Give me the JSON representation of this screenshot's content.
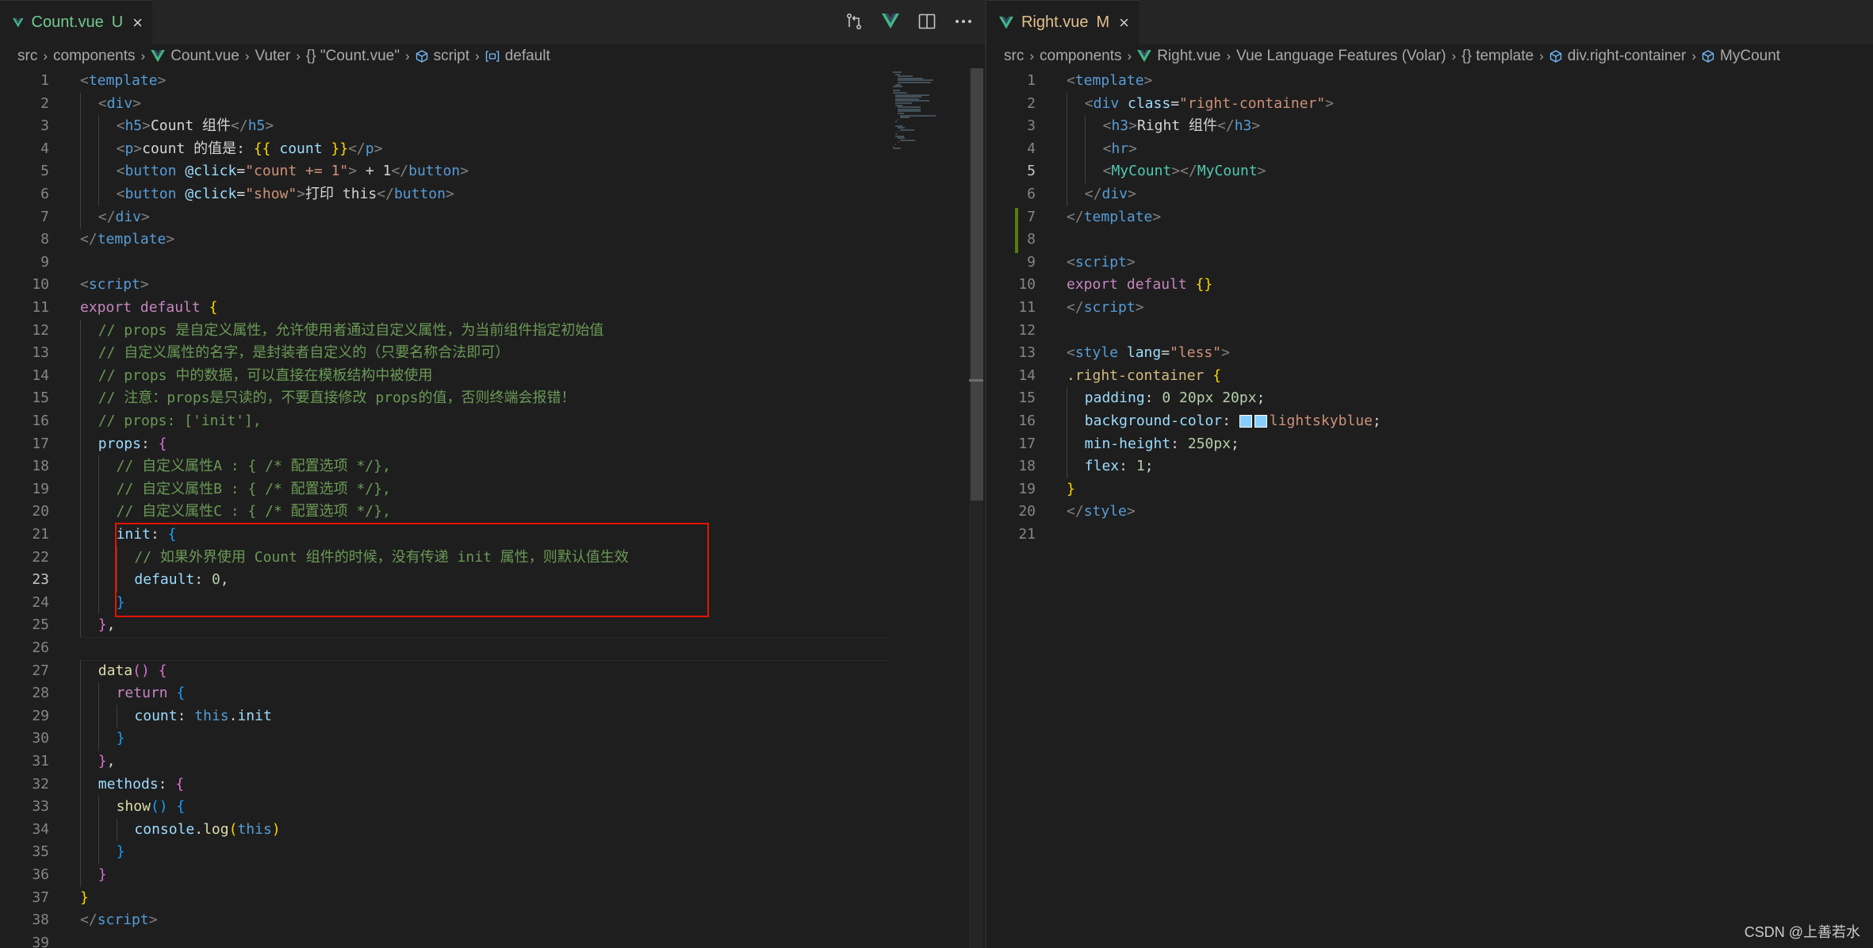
{
  "colors": {
    "background": "#1e1e1e",
    "tabbar": "#252526",
    "highlight": "#e51400",
    "git_modified": "#587c0c",
    "swatch": "#87cefa"
  },
  "left": {
    "tab": {
      "name": "Count.vue",
      "status": "U",
      "close": "×"
    },
    "breadcrumb": [
      "src",
      "components",
      "Count.vue",
      "Vuter",
      "{} \"Count.vue\"",
      "script",
      "default"
    ],
    "actions": [
      "open-changes-icon",
      "vue-preview-icon",
      "split-editor-icon",
      "more-actions-icon"
    ],
    "active_line": 23,
    "lines": [
      {
        "n": "1",
        "indent": 0,
        "t": [
          [
            "tag",
            "<"
          ],
          [
            "name",
            "template"
          ],
          [
            "tag",
            ">"
          ]
        ]
      },
      {
        "n": "2",
        "indent": 1,
        "t": [
          [
            "tag",
            "<"
          ],
          [
            "name",
            "div"
          ],
          [
            "tag",
            ">"
          ]
        ]
      },
      {
        "n": "3",
        "indent": 2,
        "t": [
          [
            "tag",
            "<"
          ],
          [
            "name",
            "h5"
          ],
          [
            "tag",
            ">"
          ],
          [
            "text",
            "Count 组件"
          ],
          [
            "tag",
            "</"
          ],
          [
            "name",
            "h5"
          ],
          [
            "tag",
            ">"
          ]
        ]
      },
      {
        "n": "4",
        "indent": 2,
        "t": [
          [
            "tag",
            "<"
          ],
          [
            "name",
            "p"
          ],
          [
            "tag",
            ">"
          ],
          [
            "text",
            "count 的值是: "
          ],
          [
            "b1",
            "{{"
          ],
          [
            "text",
            " "
          ],
          [
            "attr",
            "count"
          ],
          [
            "text",
            " "
          ],
          [
            "b1",
            "}}"
          ],
          [
            "tag",
            "</"
          ],
          [
            "name",
            "p"
          ],
          [
            "tag",
            ">"
          ]
        ]
      },
      {
        "n": "5",
        "indent": 2,
        "t": [
          [
            "tag",
            "<"
          ],
          [
            "name",
            "button"
          ],
          [
            "text",
            " "
          ],
          [
            "attr",
            "@click"
          ],
          [
            "text",
            "="
          ],
          [
            "str",
            "\"count += 1\""
          ],
          [
            "tag",
            ">"
          ],
          [
            "text",
            " + 1"
          ],
          [
            "tag",
            "</"
          ],
          [
            "name",
            "button"
          ],
          [
            "tag",
            ">"
          ]
        ]
      },
      {
        "n": "6",
        "indent": 2,
        "t": [
          [
            "tag",
            "<"
          ],
          [
            "name",
            "button"
          ],
          [
            "text",
            " "
          ],
          [
            "attr",
            "@click"
          ],
          [
            "text",
            "="
          ],
          [
            "str",
            "\"show\""
          ],
          [
            "tag",
            ">"
          ],
          [
            "text",
            "打印 this"
          ],
          [
            "tag",
            "</"
          ],
          [
            "name",
            "button"
          ],
          [
            "tag",
            ">"
          ]
        ]
      },
      {
        "n": "7",
        "indent": 1,
        "t": [
          [
            "tag",
            "</"
          ],
          [
            "name",
            "div"
          ],
          [
            "tag",
            ">"
          ]
        ]
      },
      {
        "n": "8",
        "indent": 0,
        "t": [
          [
            "tag",
            "</"
          ],
          [
            "name",
            "template"
          ],
          [
            "tag",
            ">"
          ]
        ]
      },
      {
        "n": "9",
        "indent": 0,
        "t": []
      },
      {
        "n": "10",
        "indent": 0,
        "t": [
          [
            "tag",
            "<"
          ],
          [
            "name",
            "script"
          ],
          [
            "tag",
            ">"
          ]
        ]
      },
      {
        "n": "11",
        "indent": 0,
        "t": [
          [
            "kw",
            "export"
          ],
          [
            "text",
            " "
          ],
          [
            "kw",
            "default"
          ],
          [
            "text",
            " "
          ],
          [
            "b1",
            "{"
          ]
        ]
      },
      {
        "n": "12",
        "indent": 1,
        "t": [
          [
            "cm",
            "// props 是自定义属性，允许使用者通过自定义属性，为当前组件指定初始值"
          ]
        ]
      },
      {
        "n": "13",
        "indent": 1,
        "t": [
          [
            "cm",
            "// 自定义属性的名字，是封装者自定义的（只要名称合法即可）"
          ]
        ]
      },
      {
        "n": "14",
        "indent": 1,
        "t": [
          [
            "cm",
            "// props 中的数据，可以直接在模板结构中被使用"
          ]
        ]
      },
      {
        "n": "15",
        "indent": 1,
        "t": [
          [
            "cm",
            "// 注意：props是只读的，不要直接修改 props的值，否则终端会报错！"
          ]
        ]
      },
      {
        "n": "16",
        "indent": 1,
        "t": [
          [
            "cm",
            "// props: ['init'],"
          ]
        ]
      },
      {
        "n": "17",
        "indent": 1,
        "t": [
          [
            "prop",
            "props"
          ],
          [
            "text",
            ": "
          ],
          [
            "b2",
            "{"
          ]
        ]
      },
      {
        "n": "18",
        "indent": 2,
        "t": [
          [
            "cm",
            "// 自定义属性A : { /* 配置选项 */},"
          ]
        ]
      },
      {
        "n": "19",
        "indent": 2,
        "t": [
          [
            "cm",
            "// 自定义属性B : { /* 配置选项 */},"
          ]
        ]
      },
      {
        "n": "20",
        "indent": 2,
        "t": [
          [
            "cm",
            "// 自定义属性C : { /* 配置选项 */},"
          ]
        ]
      },
      {
        "n": "21",
        "indent": 2,
        "t": [
          [
            "prop",
            "init"
          ],
          [
            "text",
            ": "
          ],
          [
            "b3",
            "{"
          ]
        ]
      },
      {
        "n": "22",
        "indent": 3,
        "t": [
          [
            "cm",
            "// 如果外界使用 Count 组件的时候，没有传递 init 属性，则默认值生效"
          ]
        ]
      },
      {
        "n": "23",
        "indent": 3,
        "t": [
          [
            "prop",
            "default"
          ],
          [
            "text",
            ": "
          ],
          [
            "num",
            "0"
          ],
          [
            "text",
            ","
          ]
        ]
      },
      {
        "n": "24",
        "indent": 2,
        "t": [
          [
            "b3",
            "}"
          ]
        ]
      },
      {
        "n": "25",
        "indent": 1,
        "t": [
          [
            "b2",
            "}"
          ],
          [
            "text",
            ","
          ]
        ]
      },
      {
        "n": "26",
        "indent": 0,
        "t": []
      },
      {
        "n": "27",
        "indent": 1,
        "t": [
          [
            "fn",
            "data"
          ],
          [
            "b2",
            "()"
          ],
          [
            "text",
            " "
          ],
          [
            "b2",
            "{"
          ]
        ]
      },
      {
        "n": "28",
        "indent": 2,
        "t": [
          [
            "kw",
            "return"
          ],
          [
            "text",
            " "
          ],
          [
            "b3",
            "{"
          ]
        ]
      },
      {
        "n": "29",
        "indent": 3,
        "t": [
          [
            "prop",
            "count"
          ],
          [
            "text",
            ": "
          ],
          [
            "this",
            "this"
          ],
          [
            "text",
            "."
          ],
          [
            "prop",
            "init"
          ]
        ]
      },
      {
        "n": "30",
        "indent": 2,
        "t": [
          [
            "b3",
            "}"
          ]
        ]
      },
      {
        "n": "31",
        "indent": 1,
        "t": [
          [
            "b2",
            "}"
          ],
          [
            "text",
            ","
          ]
        ]
      },
      {
        "n": "32",
        "indent": 1,
        "t": [
          [
            "prop",
            "methods"
          ],
          [
            "text",
            ": "
          ],
          [
            "b2",
            "{"
          ]
        ]
      },
      {
        "n": "33",
        "indent": 2,
        "t": [
          [
            "fn",
            "show"
          ],
          [
            "b3",
            "()"
          ],
          [
            "text",
            " "
          ],
          [
            "b3",
            "{"
          ]
        ]
      },
      {
        "n": "34",
        "indent": 3,
        "t": [
          [
            "prop",
            "console"
          ],
          [
            "text",
            "."
          ],
          [
            "fn",
            "log"
          ],
          [
            "b1",
            "("
          ],
          [
            "this",
            "this"
          ],
          [
            "b1",
            ")"
          ]
        ]
      },
      {
        "n": "35",
        "indent": 2,
        "t": [
          [
            "b3",
            "}"
          ]
        ]
      },
      {
        "n": "36",
        "indent": 1,
        "t": [
          [
            "b2",
            "}"
          ]
        ]
      },
      {
        "n": "37",
        "indent": 0,
        "t": [
          [
            "b1",
            "}"
          ]
        ]
      },
      {
        "n": "38",
        "indent": 0,
        "t": [
          [
            "tag",
            "</"
          ],
          [
            "name",
            "script"
          ],
          [
            "tag",
            ">"
          ]
        ]
      },
      {
        "n": "39",
        "indent": 0,
        "t": []
      }
    ]
  },
  "right": {
    "tab": {
      "name": "Right.vue",
      "status": "M",
      "close": "×"
    },
    "breadcrumb": [
      "src",
      "components",
      "Right.vue",
      "Vue Language Features (Volar)",
      "{} template",
      "div.right-container",
      "MyCount"
    ],
    "active_line": 5,
    "lines": [
      {
        "n": "1",
        "indent": 0,
        "t": [
          [
            "tag",
            "<"
          ],
          [
            "name",
            "template"
          ],
          [
            "tag",
            ">"
          ]
        ]
      },
      {
        "n": "2",
        "indent": 1,
        "t": [
          [
            "tag",
            "<"
          ],
          [
            "name",
            "div"
          ],
          [
            "text",
            " "
          ],
          [
            "attr",
            "class"
          ],
          [
            "text",
            "="
          ],
          [
            "str",
            "\"right-container\""
          ],
          [
            "tag",
            ">"
          ]
        ]
      },
      {
        "n": "3",
        "indent": 2,
        "t": [
          [
            "tag",
            "<"
          ],
          [
            "name",
            "h3"
          ],
          [
            "tag",
            ">"
          ],
          [
            "text",
            "Right 组件"
          ],
          [
            "tag",
            "</"
          ],
          [
            "name",
            "h3"
          ],
          [
            "tag",
            ">"
          ]
        ]
      },
      {
        "n": "4",
        "indent": 2,
        "t": [
          [
            "tag",
            "<"
          ],
          [
            "name",
            "hr"
          ],
          [
            "tag",
            ">"
          ]
        ]
      },
      {
        "n": "5",
        "indent": 2,
        "t": [
          [
            "tag",
            "<"
          ],
          [
            "comp",
            "MyCount"
          ],
          [
            "tag",
            "></"
          ],
          [
            "comp",
            "MyCount"
          ],
          [
            "tag",
            ">"
          ]
        ]
      },
      {
        "n": "6",
        "indent": 1,
        "t": [
          [
            "tag",
            "</"
          ],
          [
            "name",
            "div"
          ],
          [
            "tag",
            ">"
          ]
        ]
      },
      {
        "n": "7",
        "indent": 0,
        "t": [
          [
            "tag",
            "</"
          ],
          [
            "name",
            "template"
          ],
          [
            "tag",
            ">"
          ]
        ]
      },
      {
        "n": "8",
        "indent": 0,
        "t": []
      },
      {
        "n": "9",
        "indent": 0,
        "t": [
          [
            "tag",
            "<"
          ],
          [
            "name",
            "script"
          ],
          [
            "tag",
            ">"
          ]
        ]
      },
      {
        "n": "10",
        "indent": 0,
        "t": [
          [
            "kw",
            "export"
          ],
          [
            "text",
            " "
          ],
          [
            "kw",
            "default"
          ],
          [
            "text",
            " "
          ],
          [
            "b1",
            "{}"
          ]
        ]
      },
      {
        "n": "11",
        "indent": 0,
        "t": [
          [
            "tag",
            "</"
          ],
          [
            "name",
            "script"
          ],
          [
            "tag",
            ">"
          ]
        ]
      },
      {
        "n": "12",
        "indent": 0,
        "t": []
      },
      {
        "n": "13",
        "indent": 0,
        "t": [
          [
            "tag",
            "<"
          ],
          [
            "name",
            "style"
          ],
          [
            "text",
            " "
          ],
          [
            "attr",
            "lang"
          ],
          [
            "text",
            "="
          ],
          [
            "str",
            "\"less\""
          ],
          [
            "tag",
            ">"
          ]
        ]
      },
      {
        "n": "14",
        "indent": 0,
        "t": [
          [
            "sel",
            ".right-container"
          ],
          [
            "text",
            " "
          ],
          [
            "b1",
            "{"
          ]
        ]
      },
      {
        "n": "15",
        "indent": 1,
        "t": [
          [
            "prop",
            "padding"
          ],
          [
            "text",
            ": "
          ],
          [
            "num",
            "0 20px 20px"
          ],
          [
            "text",
            ";"
          ]
        ]
      },
      {
        "n": "16",
        "indent": 1,
        "t": [
          [
            "prop",
            "background-color"
          ],
          [
            "text",
            ": "
          ],
          [
            "swatch",
            ""
          ],
          [
            "swatch",
            ""
          ],
          [
            "str",
            "lightskyblue"
          ],
          [
            "text",
            ";"
          ]
        ]
      },
      {
        "n": "17",
        "indent": 1,
        "t": [
          [
            "prop",
            "min-height"
          ],
          [
            "text",
            ": "
          ],
          [
            "num",
            "250px"
          ],
          [
            "text",
            ";"
          ]
        ]
      },
      {
        "n": "18",
        "indent": 1,
        "t": [
          [
            "prop",
            "flex"
          ],
          [
            "text",
            ": "
          ],
          [
            "num",
            "1"
          ],
          [
            "text",
            ";"
          ]
        ]
      },
      {
        "n": "19",
        "indent": 0,
        "t": [
          [
            "b1",
            "}"
          ]
        ]
      },
      {
        "n": "20",
        "indent": 0,
        "t": [
          [
            "tag",
            "</"
          ],
          [
            "name",
            "style"
          ],
          [
            "tag",
            ">"
          ]
        ]
      },
      {
        "n": "21",
        "indent": 0,
        "t": []
      }
    ]
  },
  "watermark": "CSDN @上善若水"
}
